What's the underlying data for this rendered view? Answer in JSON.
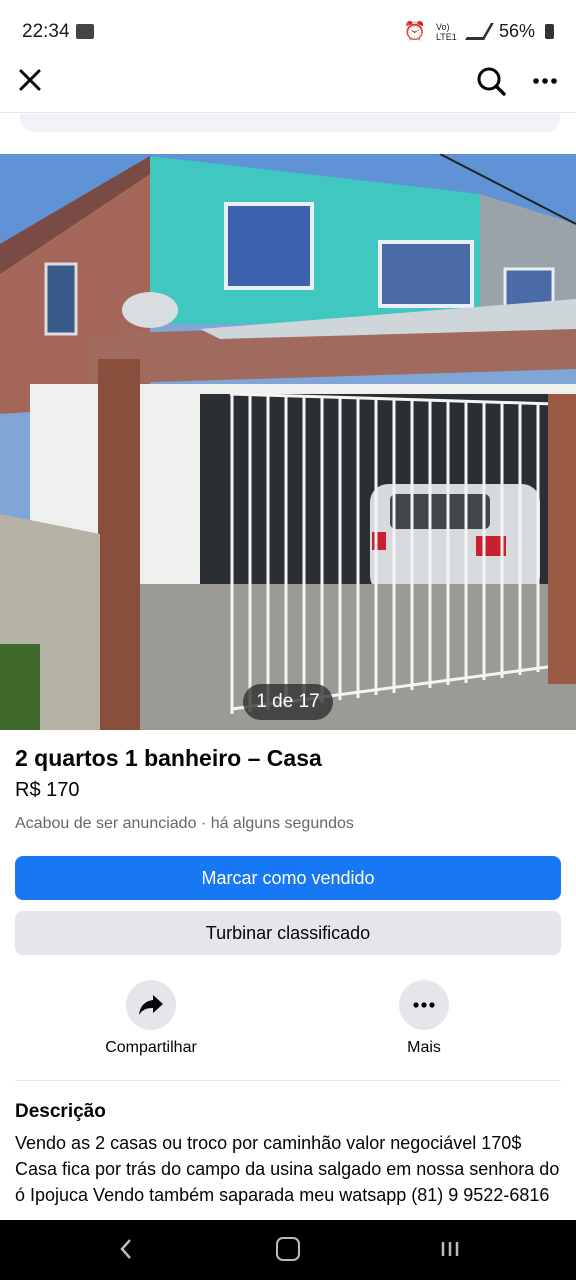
{
  "status_bar": {
    "time": "22:34",
    "network": "Vo) LTE1",
    "battery": "56%"
  },
  "topbar": {
    "close_icon": "close-icon",
    "search_icon": "search-icon",
    "more_icon": "more-icon"
  },
  "listing": {
    "photo_counter": "1 de 17",
    "title": "2 quartos 1 banheiro – Casa",
    "price": "R$ 170",
    "meta": "Acabou de ser anunciado  · há alguns segundos"
  },
  "buttons": {
    "mark_sold": "Marcar como vendido",
    "boost": "Turbinar classificado"
  },
  "actions": {
    "share": "Compartilhar",
    "more": "Mais"
  },
  "description": {
    "heading": "Descrição",
    "text": "Vendo as 2 casas ou troco por caminhão valor negociável 170$ Casa fica por trás do campo da usina salgado em nossa senhora do ó Ipojuca Vendo também saparada meu watsapp (81) 9 9522-6816"
  },
  "colors": {
    "primary": "#1877f2",
    "secondary_bg": "#e4e6eb",
    "muted_text": "#65676b"
  }
}
